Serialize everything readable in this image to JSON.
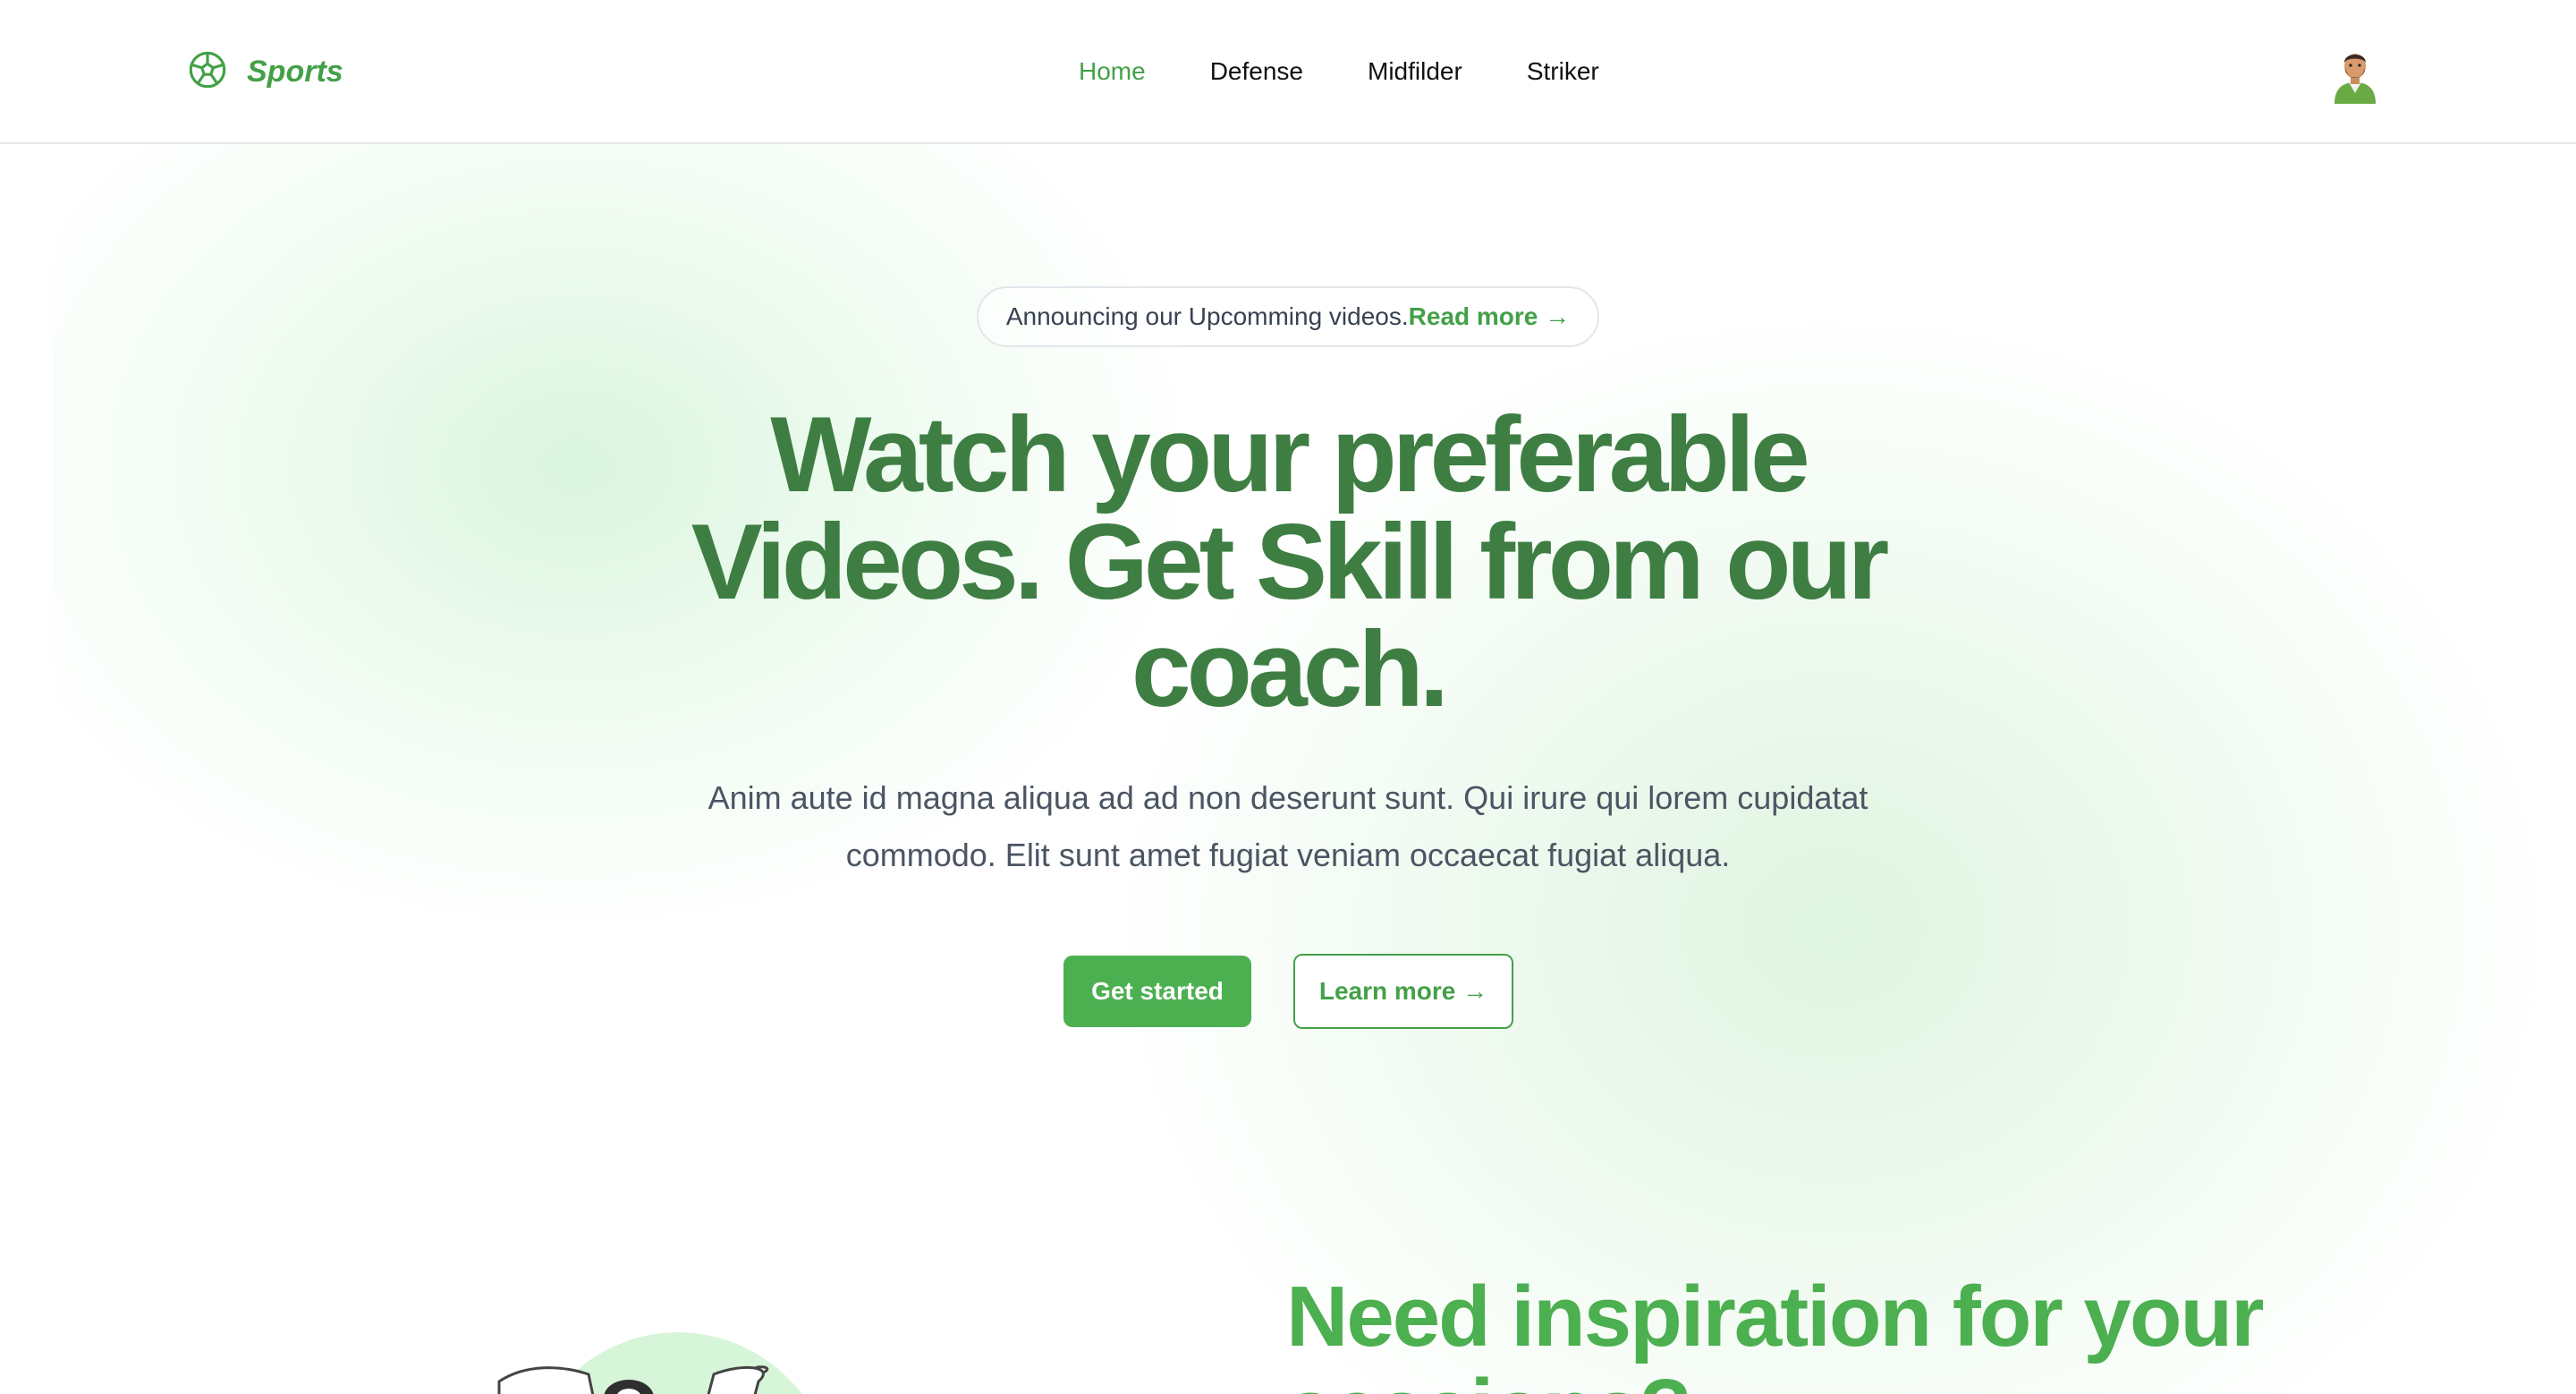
{
  "brand": {
    "name": "Sports",
    "icon": "soccer-ball-icon",
    "color": "#43a047"
  },
  "nav": {
    "items": [
      {
        "label": "Home",
        "active": true
      },
      {
        "label": "Defense",
        "active": false
      },
      {
        "label": "Midfilder",
        "active": false
      },
      {
        "label": "Striker",
        "active": false
      }
    ]
  },
  "user": {
    "avatar_icon": "user-avatar-icon"
  },
  "announcement": {
    "text": "Announcing our Upcomming videos.",
    "link": "Read more →"
  },
  "hero": {
    "title_lines": [
      "Watch your preferable",
      "Videos. Get Skill from our",
      "coach."
    ],
    "subtitle_lines": [
      "Anim aute id magna aliqua ad ad non deserunt sunt. Qui irure qui lorem cupidatat",
      "commodo. Elit sunt amet fugiat veniam occaecat fugiat aliqua."
    ],
    "primary_button": "Get started",
    "secondary_button": "Learn more →"
  },
  "inspiration": {
    "title_lines": [
      "Need inspiration for your",
      "sessions?"
    ],
    "illustration_icon": "soccer-mascot-illustration"
  },
  "colors": {
    "accent": "#43a047",
    "title": "#3e7e43",
    "button": "#4caf50"
  }
}
